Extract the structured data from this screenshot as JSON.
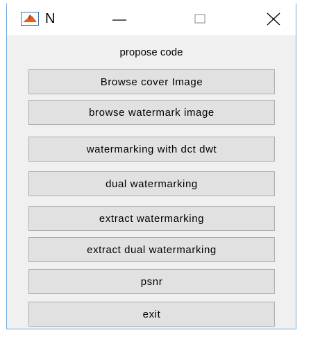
{
  "window": {
    "title": "N",
    "controls": {
      "minimize_icon": "minimize-icon",
      "maximize_icon": "maximize-icon",
      "close_icon": "close-icon"
    }
  },
  "panel": {
    "title": "propose code"
  },
  "buttons": [
    {
      "label": "Browse cover Image"
    },
    {
      "label": "browse watermark image"
    },
    {
      "label": "watermarking with dct dwt"
    },
    {
      "label": "dual watermarking"
    },
    {
      "label": "extract watermarking"
    },
    {
      "label": "extract dual watermarking"
    },
    {
      "label": "psnr"
    },
    {
      "label": "exit"
    }
  ],
  "colors": {
    "window_background": "#f0f0f0",
    "button_face": "#e1e1e1",
    "button_border": "#adadad",
    "window_border": "#6fa8dc",
    "matlab_icon_orange": "#e06020",
    "matlab_icon_blue": "#3a6fb0"
  }
}
